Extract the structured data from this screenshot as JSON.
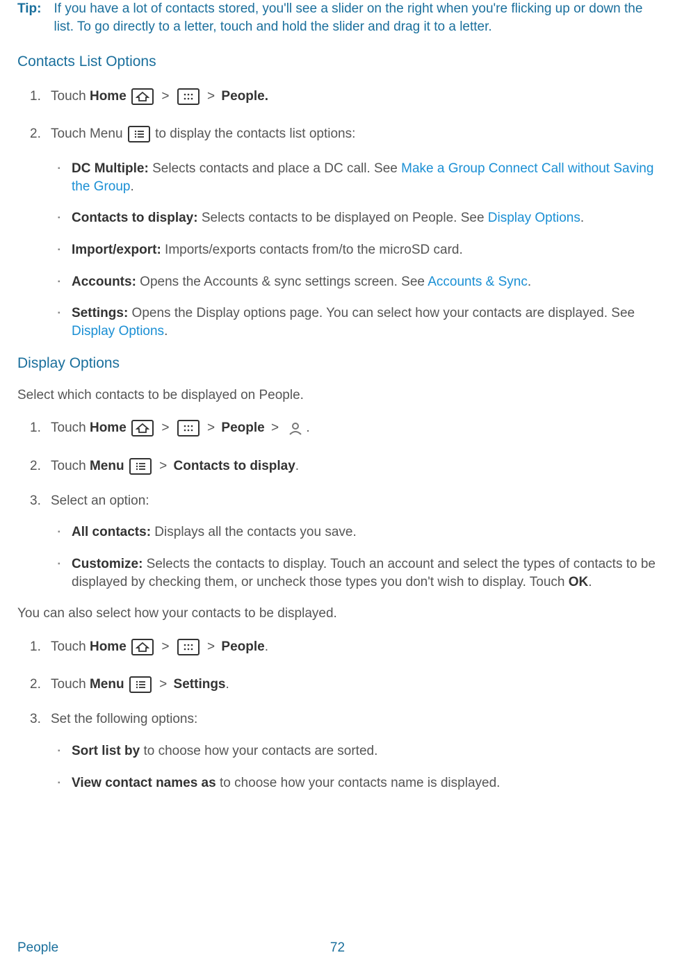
{
  "tip": {
    "label": "Tip:",
    "text": "If you have a lot of contacts stored, you'll see a slider on the right when you're flicking up or down the list. To go directly to a letter, touch and hold the slider and drag it to a letter."
  },
  "sections": {
    "contactsListOptions": {
      "heading": "Contacts List Options",
      "step1_num": "1.",
      "step1_pre": "Touch ",
      "step1_home": "Home",
      "step1_people": "People.",
      "step2_num": "2.",
      "step2_pre": "Touch Menu ",
      "step2_post": " to display the contacts list options:",
      "bullets": {
        "b1_strong": "DC Multiple:",
        "b1_text": " Selects contacts and place a DC call. See ",
        "b1_link": "Make a Group Connect Call without Saving the Group",
        "b2_strong": "Contacts to display:",
        "b2_text": " Selects contacts to be displayed on People. See ",
        "b2_link": "Display Options",
        "b3_strong": "Import/export:",
        "b3_text": " Imports/exports contacts from/to the microSD card.",
        "b4_strong": "Accounts:",
        "b4_text": " Opens the Accounts & sync settings screen. See ",
        "b4_link": "Accounts & Sync",
        "b5_strong": "Settings:",
        "b5_text": " Opens the Display options page. You can select how your contacts are displayed. See ",
        "b5_link": "Display Options"
      }
    },
    "displayOptions": {
      "heading": "Display Options",
      "intro": "Select which contacts to be displayed on People.",
      "step1_num": "1.",
      "step1_pre": "Touch ",
      "step1_home": "Home",
      "step1_people": "People",
      "step2_num": "2.",
      "step2_pre": "Touch ",
      "step2_menu": "Menu",
      "step2_ctd": "Contacts to display",
      "step3_num": "3.",
      "step3_text": "Select an option:",
      "bullets": {
        "b1_strong": "All contacts:",
        "b1_text": " Displays all the contacts you save.",
        "b2_strong": "Customize:",
        "b2_text": " Selects the contacts to display. Touch an account and select the types of contacts to be displayed by checking them, or uncheck those types you don't wish to display. Touch ",
        "b2_ok": "OK"
      },
      "para2": "You can also select how your contacts to be displayed.",
      "settings_step1_num": "1.",
      "settings_step1_pre": "Touch ",
      "settings_step1_home": "Home",
      "settings_step1_people": "People",
      "settings_step2_num": "2.",
      "settings_step2_pre": "Touch ",
      "settings_step2_menu": "Menu",
      "settings_step2_settings": "Settings",
      "settings_step3_num": "3.",
      "settings_step3_text": "Set the following options:",
      "settings_bullets": {
        "b1_strong": "Sort list by",
        "b1_text": " to choose how your contacts are sorted.",
        "b2_strong": "View contact names as",
        "b2_text": " to choose how your contacts name is displayed."
      }
    }
  },
  "symbols": {
    "gt": ">"
  },
  "footer": {
    "section": "People",
    "page": "72"
  }
}
